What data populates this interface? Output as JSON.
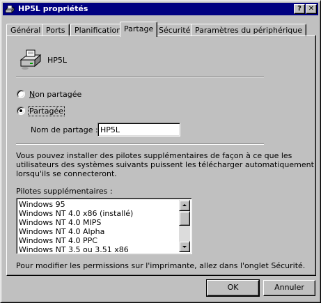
{
  "window": {
    "title": "HP5L propriétés",
    "help_button": "?",
    "close_button": "✕"
  },
  "tabs": [
    {
      "label": "Général"
    },
    {
      "label": "Ports"
    },
    {
      "label": "Planification"
    },
    {
      "label": "Partage"
    },
    {
      "label": "Sécurité"
    },
    {
      "label": "Paramètres du périphérique"
    }
  ],
  "active_tab": "Partage",
  "printer": {
    "icon": "printer-icon",
    "name": "HP5L"
  },
  "sharing": {
    "option_not_shared": {
      "label_underlined": "N",
      "label_rest": "on partagée",
      "selected": false
    },
    "option_shared": {
      "label": "Partagée",
      "selected": true
    },
    "share_name_label": "Nom de partage :",
    "share_name_value": "HP5L"
  },
  "info": {
    "line1": "Vous pouvez installer des pilotes supplémentaires de façon à ce que les",
    "line2": "utilisateurs des systèmes suivants puissent les télécharger automatiquement",
    "line3": "lorsqu'ils se connecteront."
  },
  "drivers": {
    "label": "Pilotes supplémentaires :",
    "items": [
      "Windows 95",
      "Windows NT 4.0 x86 (installé)",
      "Windows NT 4.0 MIPS",
      "Windows NT 4.0 Alpha",
      "Windows NT 4.0 PPC",
      "Windows NT 3.5 ou 3.51 x86"
    ]
  },
  "footer_note": "Pour modifier les permissions sur l'imprimante, allez dans l'onglet Sécurité.",
  "buttons": {
    "ok": "OK",
    "cancel": "Annuler"
  },
  "colors": {
    "titlebar": "#000080",
    "face": "#c0c0c0"
  }
}
